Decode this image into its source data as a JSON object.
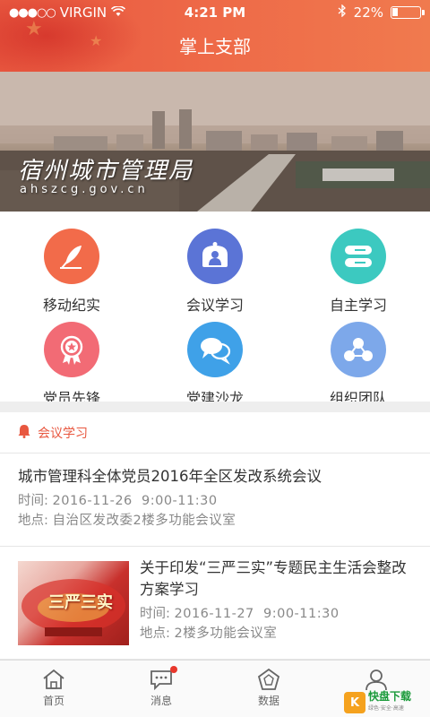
{
  "status_bar": {
    "carrier": "VIRGIN",
    "time": "4:21 PM",
    "battery": "22%",
    "battery_level": 0.22
  },
  "header": {
    "title": "掌上支部"
  },
  "banner": {
    "title": "宿州城市管理局",
    "subtitle": "ahszcg.gov.cn"
  },
  "grid": {
    "items": [
      {
        "label": "移动纪实",
        "color": "#f26b4a",
        "icon": "feather-icon"
      },
      {
        "label": "会议学习",
        "color": "#5b74d6",
        "icon": "meeting-icon"
      },
      {
        "label": "自主学习",
        "color": "#3cc9c0",
        "icon": "book-icon"
      },
      {
        "label": "党员先锋",
        "color": "#f26b75",
        "icon": "medal-icon"
      },
      {
        "label": "党建沙龙",
        "color": "#3fa1e8",
        "icon": "chat-icon"
      },
      {
        "label": "组织团队",
        "color": "#7da8ea",
        "icon": "team-icon"
      }
    ]
  },
  "section": {
    "label": "会议学习",
    "accent": "#e8573f"
  },
  "news": [
    {
      "title": "城市管理科全体党员2016年全区发改系统会议",
      "time_label": "时间:",
      "time_value": "2016-11-26  9:00-11:30",
      "place_label": "地点:",
      "place_value": "自治区发改委2楼多功能会议室"
    },
    {
      "title": "关于印发“三严三实”专题民主生活会整改方案学习",
      "time_label": "时间:",
      "time_value": "2016-11-27  9:00-11:30",
      "place_label": "地点:",
      "place_value": "2楼多功能会议室",
      "thumb_text": "三严三实"
    }
  ],
  "tabbar": {
    "items": [
      {
        "label": "首页",
        "icon": "home-icon"
      },
      {
        "label": "消息",
        "icon": "message-icon",
        "badge": true
      },
      {
        "label": "数据",
        "icon": "data-icon"
      },
      {
        "label": "",
        "icon": "profile-icon"
      }
    ]
  },
  "watermark": {
    "logo": "K",
    "text": "快盘下载",
    "tagline": "绿色·安全·高速"
  }
}
